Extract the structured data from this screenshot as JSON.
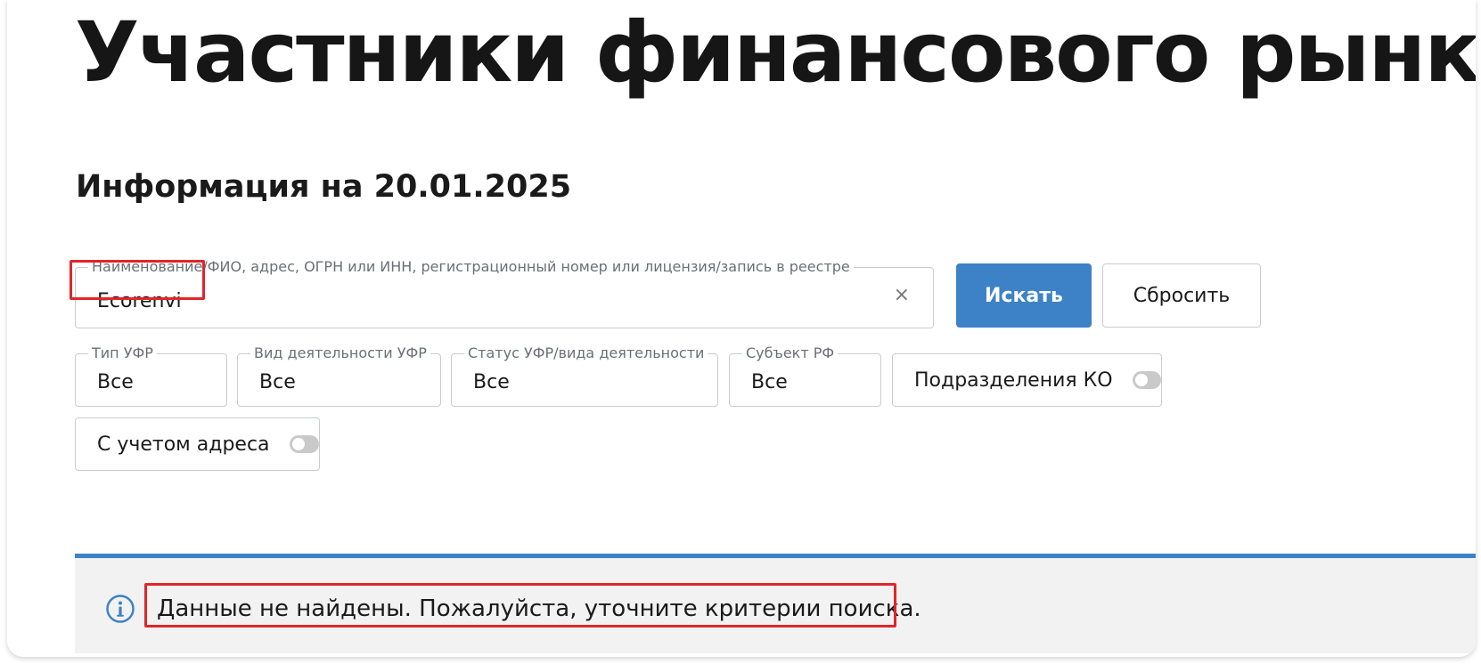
{
  "page": {
    "title": "Участники финансового рынка",
    "subtitle": "Информация на 20.01.2025"
  },
  "search": {
    "legend": "Наименование/ФИО, адрес, ОГРН или ИНН, регистрационный номер или лицензия/запись в реестре",
    "value": "Ecorenvi",
    "clear_label": "×",
    "submit_label": "Искать",
    "reset_label": "Сбросить"
  },
  "filters": [
    {
      "legend": "Тип УФР",
      "value": "Все"
    },
    {
      "legend": "Вид деятельности УФР",
      "value": "Все"
    },
    {
      "legend": "Статус УФР/вида деятельности",
      "value": "Все"
    },
    {
      "legend": "Субъект РФ",
      "value": "Все"
    }
  ],
  "toggles": {
    "ko_divisions": {
      "label": "Подразделения КО",
      "on": false
    },
    "with_address": {
      "label": "С учетом адреса",
      "on": false
    }
  },
  "alert": {
    "icon": "info-icon",
    "message": "Данные не найдены. Пожалуйста, уточните критерии поиска."
  },
  "colors": {
    "accent": "#3d82c6",
    "highlight": "#e0262a"
  }
}
